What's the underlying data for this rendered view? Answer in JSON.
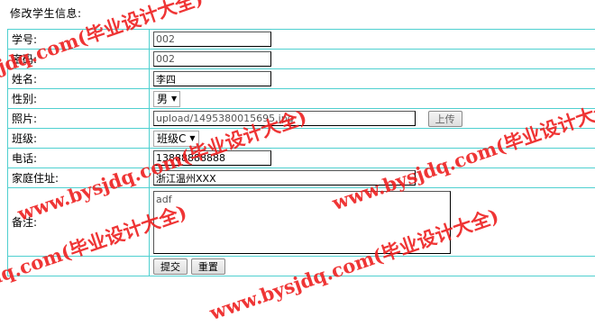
{
  "page": {
    "title": "修改学生信息:"
  },
  "form": {
    "student_id": {
      "label": "学号:",
      "value": "002"
    },
    "password": {
      "label": "密码:",
      "value": "002"
    },
    "name": {
      "label": "姓名:",
      "value": "李四"
    },
    "gender": {
      "label": "性别:",
      "selected": "男"
    },
    "photo": {
      "label": "照片:",
      "value": "upload/1495380015695.jpg",
      "upload_button": "上传"
    },
    "class": {
      "label": "班级:",
      "selected": "班级C"
    },
    "phone": {
      "label": "电话:",
      "value": "13888888888"
    },
    "address": {
      "label": "家庭住址:",
      "value": "浙江温州XXX"
    },
    "remark": {
      "label": "备注:",
      "value": "adf"
    },
    "buttons": {
      "submit": "提交",
      "reset": "重置"
    }
  },
  "watermark": {
    "text": "www.bysjdq.com(毕业设计大全)",
    "color": "#ee2020"
  }
}
